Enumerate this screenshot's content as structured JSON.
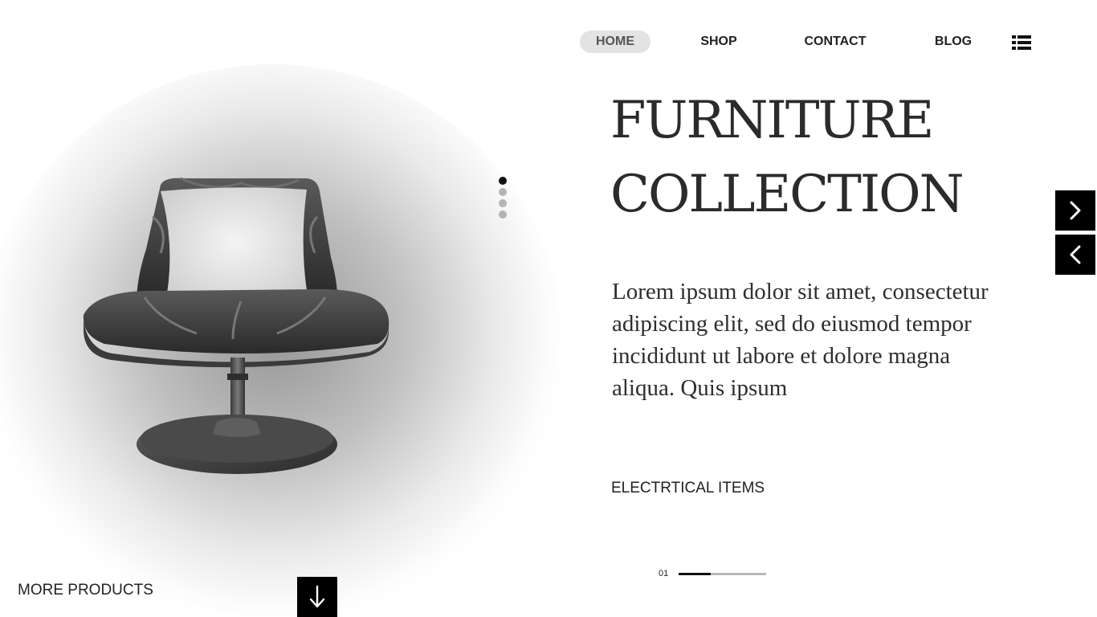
{
  "nav": {
    "items": [
      {
        "label": "HOME",
        "active": true
      },
      {
        "label": "SHOP",
        "active": false
      },
      {
        "label": "CONTACT",
        "active": false
      },
      {
        "label": "BLOG",
        "active": false
      }
    ],
    "menu_icon": "list-menu-icon"
  },
  "hero": {
    "title_line1": "FURNITURE",
    "title_line2": "COLLECTION",
    "body": "Lorem ipsum dolor sit amet, consectetur adipiscing elit, sed do eiusmod tempor incididunt ut labore et dolore magna aliqua. Quis ipsum",
    "category": "ELECTRTICAL ITEMS",
    "image_icon": "lounge-chair-image"
  },
  "slider": {
    "dots_total": 4,
    "dots_active_index": 0,
    "slide_number": "01",
    "progress_fraction": 0.37,
    "next_icon": "chevron-right-icon",
    "prev_icon": "chevron-left-icon"
  },
  "footer": {
    "more_products_label": "MORE PRODUCTS",
    "scroll_icon": "arrow-down-icon"
  },
  "colors": {
    "accent": "#000000",
    "text": "#222222",
    "nav_active_bg": "#e3e3e3",
    "dot_inactive": "#b4b4b4"
  }
}
